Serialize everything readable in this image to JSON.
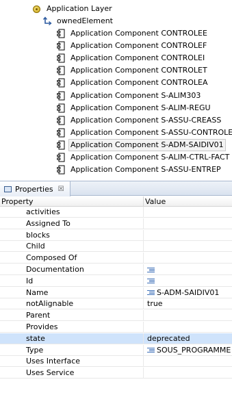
{
  "tree": {
    "root_label": "Application Layer",
    "owned_label": "ownedElement",
    "components": [
      "Application Component CONTROLEE",
      "Application Component CONTROLEF",
      "Application Component CONTROLEI",
      "Application Component CONTROLET",
      "Application Component CONTROLEA",
      "Application Component S-ALIM303",
      "Application Component S-ALIM-REGU",
      "Application Component S-ASSU-CREASS",
      "Application Component S-ASSU-CONTROLE",
      "Application Component S-ADM-SAIDIV01",
      "Application Component S-ALIM-CTRL-FACT",
      "Application Component S-ASSU-ENTREP"
    ],
    "selected_index": 9
  },
  "properties": {
    "tab_label": "Properties",
    "close_glyph": "☒",
    "header": {
      "property": "Property",
      "value": "Value"
    },
    "rows": [
      {
        "name": "activities",
        "value": ""
      },
      {
        "name": "Assigned To",
        "value": ""
      },
      {
        "name": "blocks",
        "value": ""
      },
      {
        "name": "Child",
        "value": ""
      },
      {
        "name": "Composed Of",
        "value": ""
      },
      {
        "name": "Documentation",
        "value": "",
        "icon": "text-property-icon"
      },
      {
        "name": "Id",
        "value": "",
        "icon": "text-property-icon"
      },
      {
        "name": "Name",
        "value": "S-ADM-SAIDIV01",
        "icon": "text-property-icon"
      },
      {
        "name": "notAlignable",
        "value": "true"
      },
      {
        "name": "Parent",
        "value": ""
      },
      {
        "name": "Provides",
        "value": ""
      },
      {
        "name": "state",
        "value": "deprecated",
        "selected": true
      },
      {
        "name": "Type",
        "value": "SOUS_PROGRAMME",
        "icon": "text-property-icon"
      },
      {
        "name": "Uses Interface",
        "value": ""
      },
      {
        "name": "Uses Service",
        "value": ""
      }
    ]
  },
  "colors": {
    "selection": "#cfe3fb",
    "tab_bar": "#d9e2ef",
    "icon_blue": "#3d6fb8"
  }
}
